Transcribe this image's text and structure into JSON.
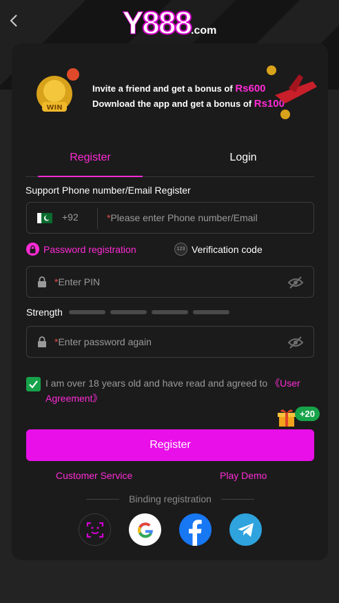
{
  "header": {
    "logo_main": "Y",
    "logo_num": "888",
    "logo_domain": ".com",
    "back_icon": "chevron-left-icon"
  },
  "banner": {
    "line1_text": "Invite a friend and get a bonus of",
    "line1_amount": "Rs600",
    "line2_text": "Download the app and get a bonus of",
    "line2_amount": "Rs100",
    "badge_text": "WIN"
  },
  "tabs": [
    {
      "label": "Register",
      "active": true
    },
    {
      "label": "Login",
      "active": false
    }
  ],
  "form": {
    "section_label": "Support Phone number/Email Register",
    "country_code": "+92",
    "phone_placeholder": "Please enter Phone number/Email",
    "mode_password": "Password registration",
    "mode_code": "Verification code",
    "mode_code_icon_text": "123",
    "pin_placeholder": "Enter PIN",
    "strength_label": "Strength",
    "strength_level": 0,
    "strength_segments": 4,
    "password_again_placeholder": "Enter password again",
    "required_mark": "*"
  },
  "agreement": {
    "checked": true,
    "text": "I am over 18 years old and have read and agreed to ",
    "link_text": "《User Agreement》"
  },
  "reward_badge": "+20",
  "register_button": "Register",
  "links": {
    "customer_service": "Customer Service",
    "play_demo": "Play Demo"
  },
  "binding_label": "Binding registration",
  "social": [
    "face-id-icon",
    "google-icon",
    "facebook-icon",
    "telegram-icon"
  ],
  "colors": {
    "accent": "#e80fe8",
    "accent_text": "#ff2bd6",
    "check_green": "#17a34a",
    "background": "#232323",
    "card": "#1b1b1b"
  }
}
